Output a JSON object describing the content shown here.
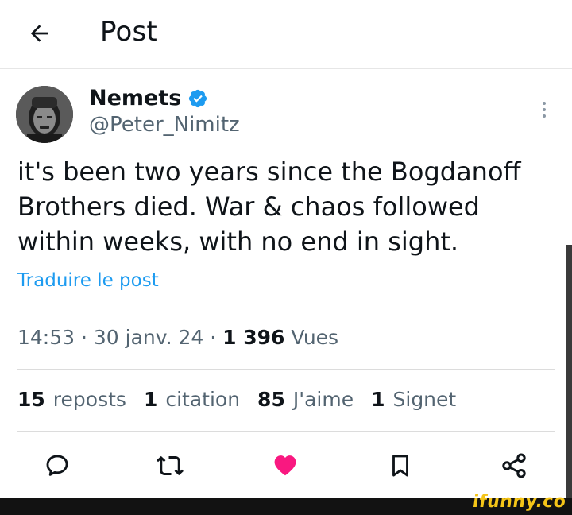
{
  "header": {
    "title": "Post",
    "back_icon": "arrow-left-icon"
  },
  "author": {
    "name": "Nemets",
    "handle": "@Peter_Nimitz",
    "verified_color": "#1d9bf0",
    "avatar_alt": "profile photo"
  },
  "post": {
    "text": "it's been two years since the Bogdanoff Brothers died. War & chaos followed within weeks, with no end in sight.",
    "translate_label": "Traduire le post"
  },
  "meta": {
    "time": "14:53",
    "date": "30 janv. 24",
    "views_count": "1 396",
    "views_label": "Vues"
  },
  "stats": [
    {
      "num": "15",
      "label": "reposts"
    },
    {
      "num": "1",
      "label": "citation"
    },
    {
      "num": "85",
      "label": "J'aime"
    },
    {
      "num": "1",
      "label": "Signet"
    }
  ],
  "actions": {
    "reply_icon": "reply-icon",
    "repost_icon": "repost-icon",
    "like_icon": "heart-icon",
    "like_color": "#f91880",
    "bookmark_icon": "bookmark-icon",
    "share_icon": "share-icon"
  },
  "watermark": "ifunny.co"
}
